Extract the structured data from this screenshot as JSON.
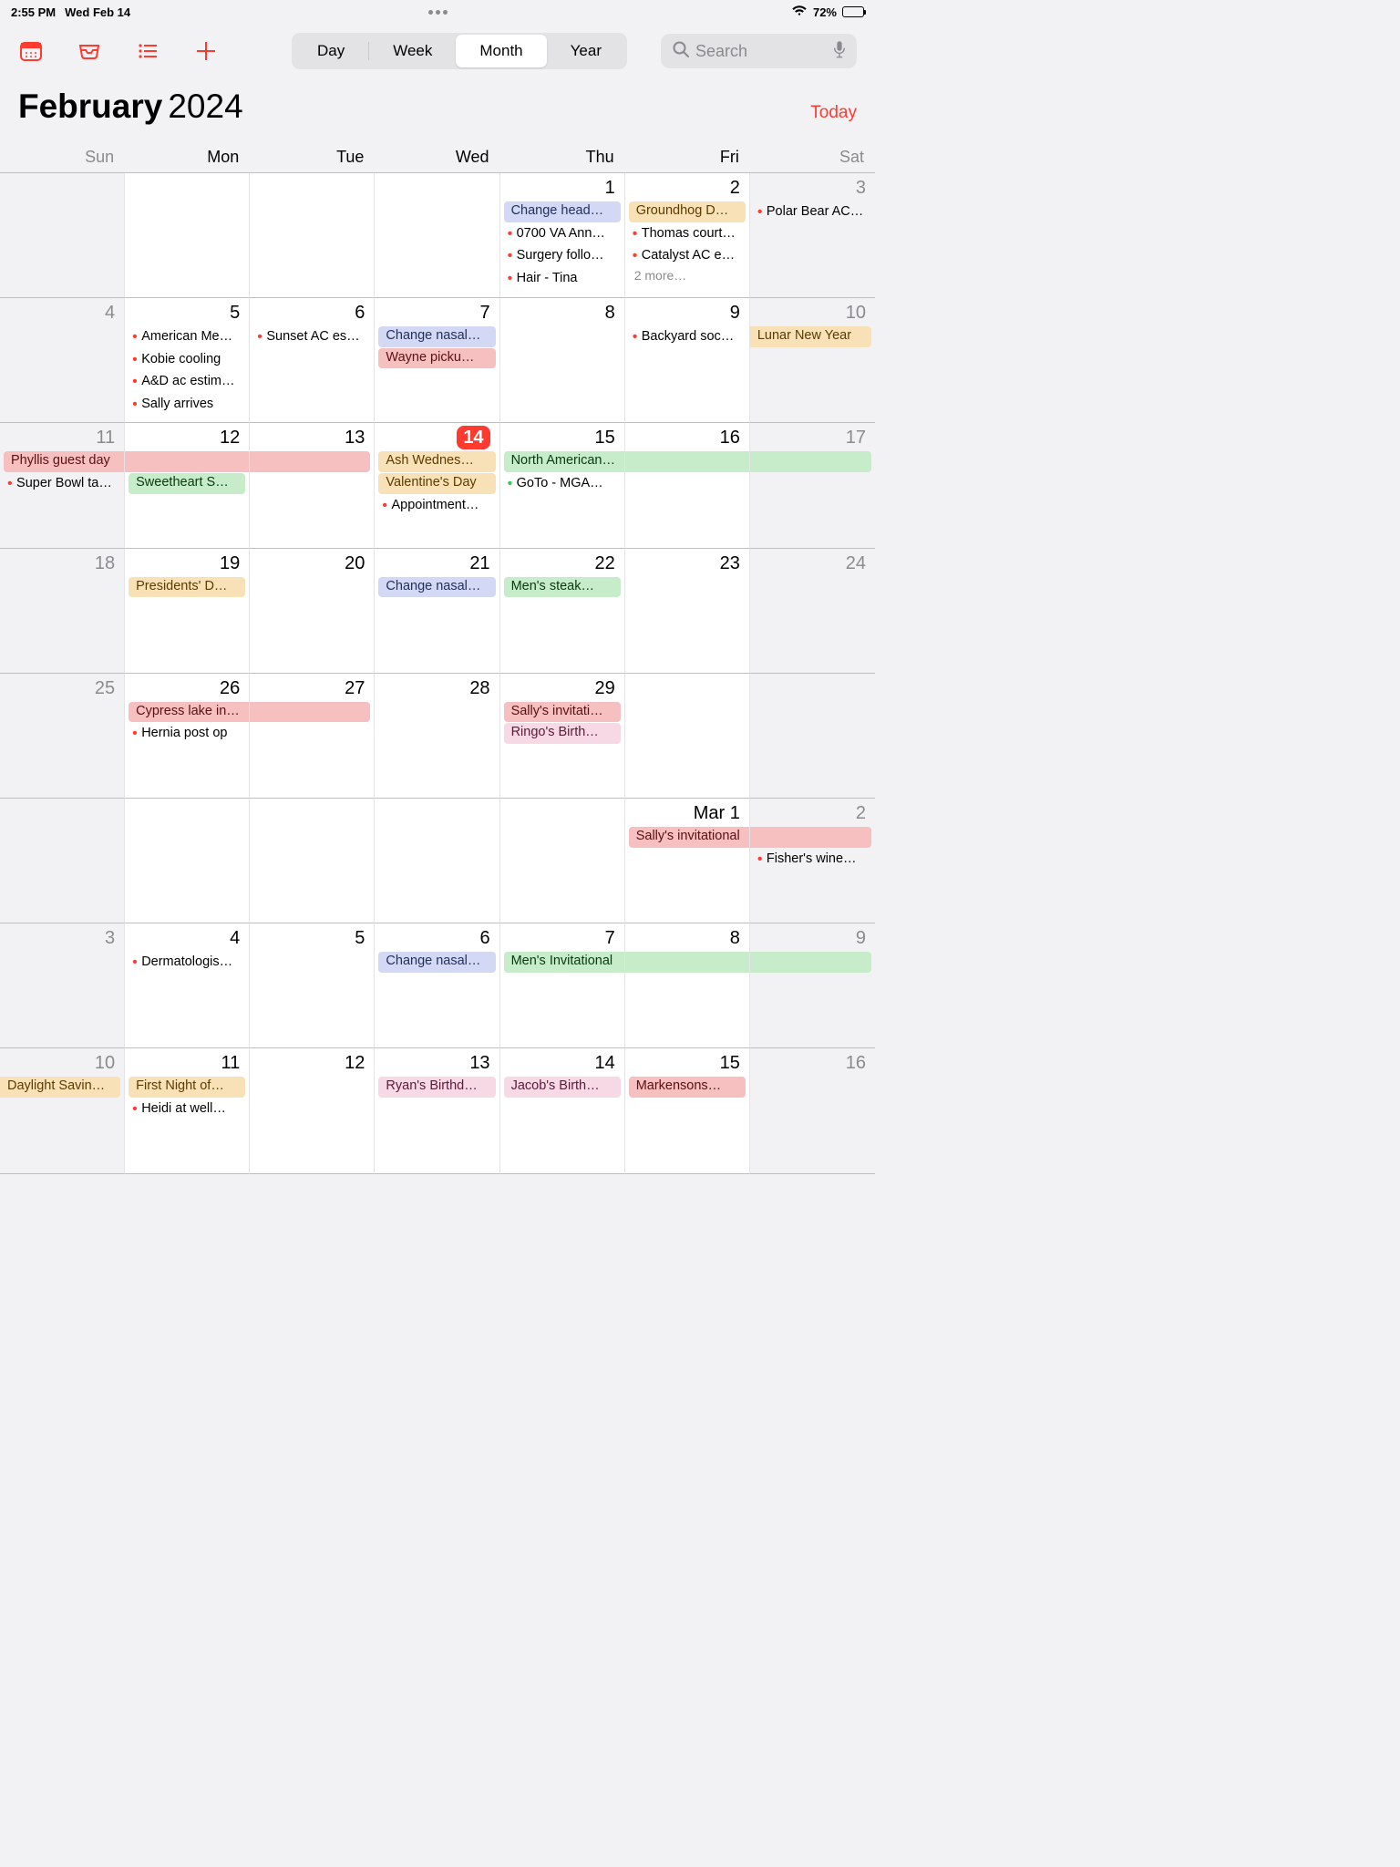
{
  "status": {
    "time": "2:55 PM",
    "date": "Wed Feb 14",
    "battery": "72%"
  },
  "seg": {
    "day": "Day",
    "week": "Week",
    "month": "Month",
    "year": "Year"
  },
  "search": {
    "placeholder": "Search"
  },
  "header": {
    "month": "February",
    "year": "2024",
    "today": "Today"
  },
  "wdays": [
    "Sun",
    "Mon",
    "Tue",
    "Wed",
    "Thu",
    "Fri",
    "Sat"
  ],
  "rows": [
    [
      {
        "n": "",
        "dim": true,
        "events": []
      },
      {
        "n": "",
        "events": []
      },
      {
        "n": "",
        "events": []
      },
      {
        "n": "",
        "events": []
      },
      {
        "n": "1",
        "events": [
          {
            "t": "Change head…",
            "cls": "c-blue"
          },
          {
            "t": "0700 VA Ann…",
            "bullet": true
          },
          {
            "t": "Surgery follo…",
            "bullet": true
          },
          {
            "t": "Hair - Tina",
            "bullet": true
          }
        ]
      },
      {
        "n": "2",
        "events": [
          {
            "t": "Groundhog D…",
            "cls": "c-orange"
          },
          {
            "t": "Thomas court…",
            "bullet": true
          },
          {
            "t": "Catalyst AC e…",
            "bullet": true
          }
        ],
        "more": "2 more…"
      },
      {
        "n": "3",
        "dim": true,
        "events": [
          {
            "t": "Polar Bear AC…",
            "bullet": true
          }
        ]
      }
    ],
    [
      {
        "n": "4",
        "dim": true,
        "events": []
      },
      {
        "n": "5",
        "events": [
          {
            "t": "American Me…",
            "bullet": true
          },
          {
            "t": "Kobie cooling",
            "bullet": true
          },
          {
            "t": "A&D ac estim…",
            "bullet": true
          },
          {
            "t": "Sally arrives",
            "bullet": true
          }
        ]
      },
      {
        "n": "6",
        "events": [
          {
            "t": "Sunset AC es…",
            "bullet": true
          }
        ]
      },
      {
        "n": "7",
        "events": [
          {
            "t": "Change nasal…",
            "cls": "c-blue"
          },
          {
            "t": "Wayne picku…",
            "cls": "c-red"
          }
        ]
      },
      {
        "n": "8",
        "events": []
      },
      {
        "n": "9",
        "events": [
          {
            "t": "Backyard soc…",
            "bullet": true
          }
        ]
      },
      {
        "n": "10",
        "dim": true,
        "events": [
          {
            "t": "Lunar New Year",
            "cls": "c-orange span-l"
          }
        ]
      }
    ],
    [
      {
        "n": "11",
        "dim": true,
        "events": [
          {
            "t": "Phyllis guest day",
            "cls": "c-red span-r"
          },
          {
            "t": "Super Bowl ta…",
            "bullet": true
          }
        ]
      },
      {
        "n": "12",
        "events": [
          {
            "t": " ",
            "cls": "c-red span"
          },
          {
            "t": "Sweetheart S…",
            "cls": "c-green"
          }
        ]
      },
      {
        "n": "13",
        "events": [
          {
            "t": " ",
            "cls": "c-red span-l"
          }
        ]
      },
      {
        "n": "14",
        "today": true,
        "events": [
          {
            "t": "Ash Wednes…",
            "cls": "c-orange"
          },
          {
            "t": "Valentine's Day",
            "cls": "c-orange"
          },
          {
            "t": "Appointment…",
            "bullet": true
          }
        ]
      },
      {
        "n": "15",
        "events": [
          {
            "t": "North American Cup",
            "cls": "c-green span-r"
          },
          {
            "t": "GoTo - MGA…",
            "bullet": true,
            "bc": "#34c759"
          }
        ]
      },
      {
        "n": "16",
        "events": [
          {
            "t": " ",
            "cls": "c-green span"
          }
        ]
      },
      {
        "n": "17",
        "dim": true,
        "events": [
          {
            "t": " ",
            "cls": "c-green span-l"
          }
        ]
      }
    ],
    [
      {
        "n": "18",
        "dim": true,
        "events": []
      },
      {
        "n": "19",
        "events": [
          {
            "t": "Presidents' D…",
            "cls": "c-orange"
          }
        ]
      },
      {
        "n": "20",
        "events": []
      },
      {
        "n": "21",
        "events": [
          {
            "t": "Change nasal…",
            "cls": "c-blue"
          }
        ]
      },
      {
        "n": "22",
        "events": [
          {
            "t": "Men's steak…",
            "cls": "c-green"
          }
        ]
      },
      {
        "n": "23",
        "events": []
      },
      {
        "n": "24",
        "dim": true,
        "events": []
      }
    ],
    [
      {
        "n": "25",
        "dim": true,
        "events": []
      },
      {
        "n": "26",
        "events": [
          {
            "t": "Cypress lake invitational",
            "cls": "c-red span-r"
          },
          {
            "t": "Hernia post op",
            "bullet": true
          }
        ]
      },
      {
        "n": "27",
        "events": [
          {
            "t": " ",
            "cls": "c-red span-l"
          }
        ]
      },
      {
        "n": "28",
        "events": []
      },
      {
        "n": "29",
        "events": [
          {
            "t": "Sally's invitati…",
            "cls": "c-red"
          },
          {
            "t": "Ringo's Birth…",
            "cls": "c-pink"
          }
        ]
      },
      {
        "n": "",
        "events": []
      },
      {
        "n": "",
        "dim": true,
        "events": []
      }
    ],
    [
      {
        "n": "",
        "dim": true,
        "events": []
      },
      {
        "n": "",
        "events": []
      },
      {
        "n": "",
        "events": []
      },
      {
        "n": "",
        "events": []
      },
      {
        "n": "",
        "events": []
      },
      {
        "n": "Mar 1",
        "events": [
          {
            "t": "Sally's invitational",
            "cls": "c-red span-r"
          }
        ]
      },
      {
        "n": "2",
        "dim": true,
        "events": [
          {
            "t": " ",
            "cls": "c-red span-l"
          },
          {
            "t": "Fisher's wine…",
            "bullet": true
          }
        ]
      }
    ],
    [
      {
        "n": "3",
        "dim": true,
        "events": []
      },
      {
        "n": "4",
        "events": [
          {
            "t": "Dermatologis…",
            "bullet": true
          }
        ]
      },
      {
        "n": "5",
        "events": []
      },
      {
        "n": "6",
        "events": [
          {
            "t": "Change nasal…",
            "cls": "c-blue"
          }
        ]
      },
      {
        "n": "7",
        "events": [
          {
            "t": "Men's Invitational",
            "cls": "c-green span-r"
          }
        ]
      },
      {
        "n": "8",
        "events": [
          {
            "t": " ",
            "cls": "c-green span"
          }
        ]
      },
      {
        "n": "9",
        "dim": true,
        "events": [
          {
            "t": " ",
            "cls": "c-green span-l"
          }
        ]
      }
    ],
    [
      {
        "n": "10",
        "dim": true,
        "events": [
          {
            "t": "Daylight Savin…",
            "cls": "c-orange span-l"
          }
        ]
      },
      {
        "n": "11",
        "events": [
          {
            "t": "First Night of…",
            "cls": "c-orange"
          },
          {
            "t": "Heidi at well…",
            "bullet": true
          }
        ]
      },
      {
        "n": "12",
        "events": []
      },
      {
        "n": "13",
        "events": [
          {
            "t": "Ryan's Birthd…",
            "cls": "c-pink"
          }
        ]
      },
      {
        "n": "14",
        "events": [
          {
            "t": "Jacob's Birth…",
            "cls": "c-pink"
          }
        ]
      },
      {
        "n": "15",
        "events": [
          {
            "t": "Markensons…",
            "cls": "c-red"
          }
        ]
      },
      {
        "n": "16",
        "dim": true,
        "events": []
      }
    ]
  ]
}
